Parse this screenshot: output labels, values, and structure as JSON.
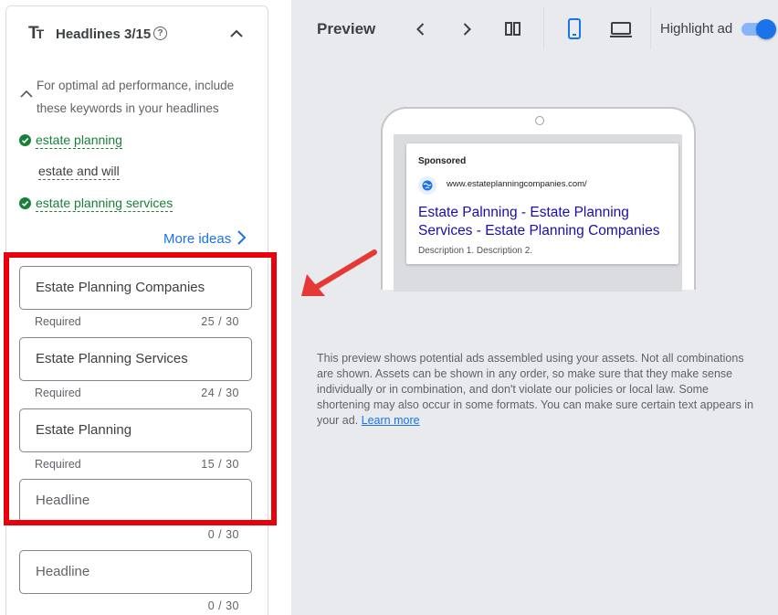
{
  "left": {
    "title": "Headlines 3/15",
    "tt_glyph": "T",
    "tt_glyph_small": "T",
    "help_glyph": "?",
    "suggestion_text": "For optimal ad performance, include these keywords in your headlines",
    "keywords": [
      {
        "text": "estate planning",
        "used": true
      },
      {
        "text": "estate and will",
        "used": false
      },
      {
        "text": "estate planning services",
        "used": true
      }
    ],
    "more_ideas": "More ideas",
    "headlines": [
      {
        "value": "Estate Planning Companies",
        "helper": "Required",
        "count": "25 / 30"
      },
      {
        "value": "Estate Planning Services",
        "helper": "Required",
        "count": "24 / 30"
      },
      {
        "value": "Estate Planning",
        "helper": "Required",
        "count": "15 / 30"
      },
      {
        "placeholder": "Headline",
        "count": "0 / 30"
      },
      {
        "placeholder": "Headline",
        "count": "0 / 30"
      }
    ]
  },
  "preview": {
    "title": "Preview",
    "highlight_label": "Highlight ad",
    "highlight_on": true,
    "ad": {
      "sponsored": "Sponsored",
      "url": "www.estateplanningcompanies.com/",
      "headline": "Estate Palnning - Estate Planning Services - Estate Planning Companies",
      "description": "Description 1. Description 2."
    },
    "info": "This preview shows potential ads assembled using your assets. Not all combinations are shown. Assets can be shown in any order, so make sure that they make sense individually or in combination, and don't violate our policies or local law. Some shortening may also occur in some formats. You can make sure certain text appears in your ad.",
    "learn_more": "Learn more"
  },
  "colors": {
    "accent": "#1a73e8",
    "keyword_green": "#188038",
    "highlight_red": "#e8000d",
    "ad_link": "#1a0dab"
  }
}
